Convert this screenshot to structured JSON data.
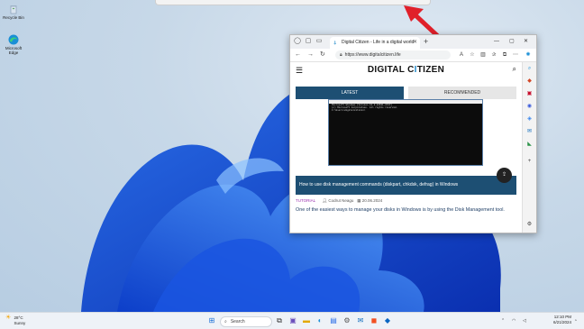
{
  "desktop": {
    "icons": [
      {
        "name": "recycle-bin",
        "label": "Recycle Bin"
      },
      {
        "name": "microsoft-edge",
        "label": "Microsoft Edge"
      }
    ]
  },
  "browser": {
    "tab_title": "Digital Citizen - Life in a digital world",
    "url": "https://www.digitalcitizen.life",
    "site": {
      "logo_text_pre": "DIGITAL C",
      "logo_text_i": "I",
      "logo_text_post": "TIZEN",
      "tab_latest": "LATEST",
      "tab_recommended": "RECOMMENDED",
      "article_title": "How to use disk management commands (diskpart, chkdsk, defrag) in Windows",
      "tag": "TUTORIAL",
      "author": "Codrut Neagu",
      "date": "20.06.2024",
      "excerpt": "One of the easiest ways to manage your disks in Windows is by using the Disk Management tool.",
      "cmd_title": "Command Prompt",
      "cmd_lines": [
        "Microsoft Windows [Version 10.0.22631.3737]",
        "(c) Microsoft Corporation. All rights reserved.",
        "",
        "C:\\Users\\digitalcitizen>"
      ]
    }
  },
  "taskbar": {
    "weather_temp": "28°C",
    "weather_desc": "Sunny",
    "search_placeholder": "Search",
    "time": "12:10 PM",
    "date": "6/21/2024"
  },
  "colors": {
    "accent": "#1d4f73",
    "arrow": "#e0202a",
    "brand_i": "#1e88c8"
  }
}
